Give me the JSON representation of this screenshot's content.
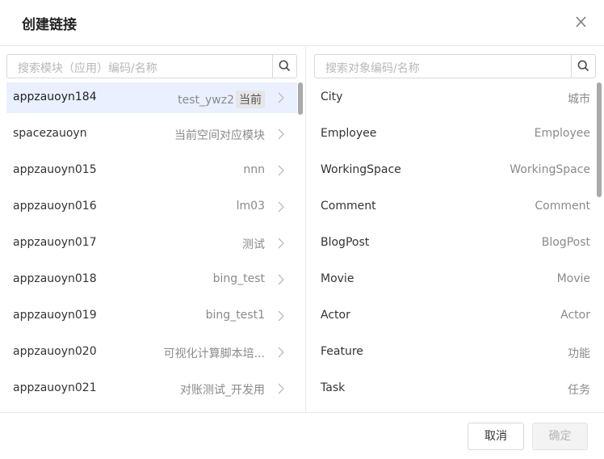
{
  "dialog": {
    "title": "创建链接"
  },
  "left": {
    "search_placeholder": "搜索模块（应用）编码/名称",
    "items": [
      {
        "name": "appzauoyn184",
        "value": "test_ywz2",
        "badge": "当前"
      },
      {
        "name": "spacezauoyn",
        "value": "当前空间对应模块"
      },
      {
        "name": "appzauoyn015",
        "value": "nnn"
      },
      {
        "name": "appzauoyn016",
        "value": "lm03"
      },
      {
        "name": "appzauoyn017",
        "value": "测试"
      },
      {
        "name": "appzauoyn018",
        "value": "bing_test"
      },
      {
        "name": "appzauoyn019",
        "value": "bing_test1"
      },
      {
        "name": "appzauoyn020",
        "value": "可视化计算脚本培..."
      },
      {
        "name": "appzauoyn021",
        "value": "对账测试_开发用"
      }
    ]
  },
  "right": {
    "search_placeholder": "搜索对象编码/名称",
    "items": [
      {
        "name": "City",
        "value": "城市"
      },
      {
        "name": "Employee",
        "value": "Employee"
      },
      {
        "name": "WorkingSpace",
        "value": "WorkingSpace"
      },
      {
        "name": "Comment",
        "value": "Comment"
      },
      {
        "name": "BlogPost",
        "value": "BlogPost"
      },
      {
        "name": "Movie",
        "value": "Movie"
      },
      {
        "name": "Actor",
        "value": "Actor"
      },
      {
        "name": "Feature",
        "value": "功能"
      },
      {
        "name": "Task",
        "value": "任务"
      }
    ]
  },
  "footer": {
    "cancel_label": "取消",
    "ok_label": "确定"
  }
}
